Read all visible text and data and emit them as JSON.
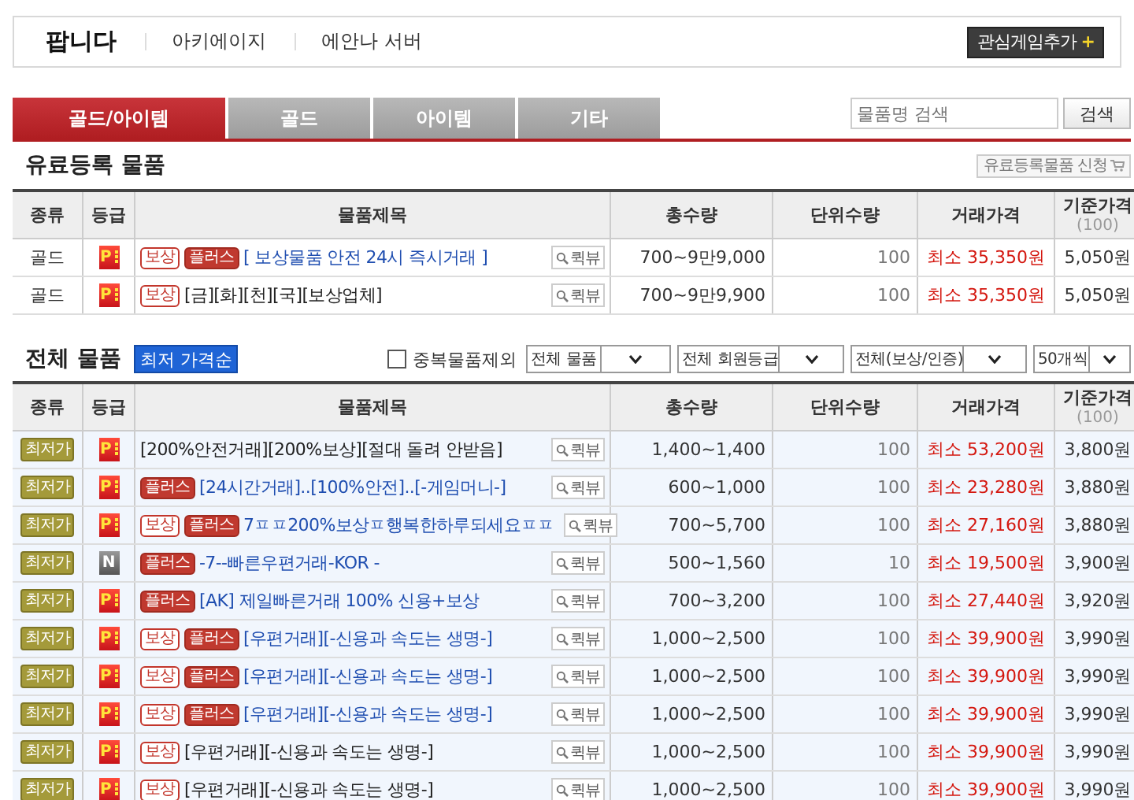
{
  "header": {
    "title": "팝니다",
    "game": "아키에이지",
    "server": "에안나 서버",
    "add_button": "관심게임추가",
    "add_icon": "+"
  },
  "tabs": [
    {
      "label": "골드/아이템",
      "selected": true
    },
    {
      "label": "골드",
      "selected": false
    },
    {
      "label": "아이템",
      "selected": false
    },
    {
      "label": "기타",
      "selected": false
    }
  ],
  "search": {
    "placeholder": "물품명 검색",
    "button": "검색"
  },
  "premium": {
    "title": "유료등록 물품",
    "apply_button": "유료등록물품 신청",
    "columns": [
      {
        "label": "종류"
      },
      {
        "label": "등급"
      },
      {
        "label": "물품제목"
      },
      {
        "label": "총수량"
      },
      {
        "label": "단위수량"
      },
      {
        "label": "거래가격"
      },
      {
        "label": "기준가격",
        "sub": "(100)"
      }
    ],
    "rows": [
      {
        "kind": "text",
        "type": "골드",
        "grade": "P",
        "tags": [
          {
            "kind": "compensation",
            "label": "보상"
          },
          {
            "kind": "plus",
            "label": "플러스"
          }
        ],
        "title": "[ 보상물품 안전 24시 즉시거래 ]",
        "highlighted": true,
        "quick_view": "퀵뷰",
        "total": "700~9만9,000",
        "unit": "100",
        "price": "최소 35,350원",
        "base": "5,050원"
      },
      {
        "kind": "text",
        "type": "골드",
        "grade": "P",
        "tags": [
          {
            "kind": "compensation",
            "label": "보상"
          }
        ],
        "title": "[금][화][천][국][보상업체]",
        "highlighted": false,
        "quick_view": "퀵뷰",
        "total": "700~9만9,900",
        "unit": "100",
        "price": "최소 35,350원",
        "base": "5,050원"
      }
    ]
  },
  "all": {
    "title": "전체 물품",
    "sort_button": "최저 가격순",
    "exclude": {
      "label": "중복물품제외",
      "checked": false
    },
    "filters": [
      "전체 물품",
      "전체 회원등급",
      "전체(보상/인증)",
      "50개씩"
    ],
    "columns": [
      {
        "label": "종류"
      },
      {
        "label": "등급"
      },
      {
        "label": "물품제목"
      },
      {
        "label": "총수량"
      },
      {
        "label": "단위수량"
      },
      {
        "label": "거래가격"
      },
      {
        "label": "기준가격",
        "sub": "(100)"
      }
    ],
    "rows": [
      {
        "kind": "badge",
        "type": "최저가",
        "grade": "P",
        "tags": [],
        "title": "[200%안전거래][200%보상][절대 돌려 안받음]",
        "highlighted": false,
        "quick_view": "퀵뷰",
        "total": "1,400~1,400",
        "unit": "100",
        "price": "최소 53,200원",
        "base": "3,800원"
      },
      {
        "kind": "badge",
        "type": "최저가",
        "grade": "P",
        "tags": [
          {
            "kind": "plus",
            "label": "플러스"
          }
        ],
        "title": "[24시간거래]..[100%안전]..[-게임머니-]",
        "highlighted": true,
        "quick_view": "퀵뷰",
        "total": "600~1,000",
        "unit": "100",
        "price": "최소 23,280원",
        "base": "3,880원"
      },
      {
        "kind": "badge",
        "type": "최저가",
        "grade": "P",
        "tags": [
          {
            "kind": "compensation",
            "label": "보상"
          },
          {
            "kind": "plus",
            "label": "플러스"
          }
        ],
        "title": "7ㅍㅍ200%보상ㅍ행복한하루되세요ㅍㅍ",
        "highlighted": true,
        "quick_view": "퀵뷰",
        "total": "700~5,700",
        "unit": "100",
        "price": "최소 27,160원",
        "base": "3,880원"
      },
      {
        "kind": "badge",
        "type": "최저가",
        "grade": "N",
        "tags": [
          {
            "kind": "plus",
            "label": "플러스"
          }
        ],
        "title": "-7--빠른우편거래-KOR -",
        "highlighted": true,
        "quick_view": "퀵뷰",
        "total": "500~1,560",
        "unit": "10",
        "price": "최소 19,500원",
        "base": "3,900원"
      },
      {
        "kind": "badge",
        "type": "최저가",
        "grade": "P",
        "tags": [
          {
            "kind": "plus",
            "label": "플러스"
          }
        ],
        "title": "[AK] 제일빠른거래 100% 신용+보상",
        "highlighted": true,
        "quick_view": "퀵뷰",
        "total": "700~3,200",
        "unit": "100",
        "price": "최소 27,440원",
        "base": "3,920원"
      },
      {
        "kind": "badge",
        "type": "최저가",
        "grade": "P",
        "tags": [
          {
            "kind": "compensation",
            "label": "보상"
          },
          {
            "kind": "plus",
            "label": "플러스"
          }
        ],
        "title": "[우편거래][-신용과 속도는 생명-]",
        "highlighted": true,
        "quick_view": "퀵뷰",
        "total": "1,000~2,500",
        "unit": "100",
        "price": "최소 39,900원",
        "base": "3,990원"
      },
      {
        "kind": "badge",
        "type": "최저가",
        "grade": "P",
        "tags": [
          {
            "kind": "compensation",
            "label": "보상"
          },
          {
            "kind": "plus",
            "label": "플러스"
          }
        ],
        "title": "[우편거래][-신용과 속도는 생명-]",
        "highlighted": true,
        "quick_view": "퀵뷰",
        "total": "1,000~2,500",
        "unit": "100",
        "price": "최소 39,900원",
        "base": "3,990원"
      },
      {
        "kind": "badge",
        "type": "최저가",
        "grade": "P",
        "tags": [
          {
            "kind": "compensation",
            "label": "보상"
          },
          {
            "kind": "plus",
            "label": "플러스"
          }
        ],
        "title": "[우편거래][-신용과 속도는 생명-]",
        "highlighted": true,
        "quick_view": "퀵뷰",
        "total": "1,000~2,500",
        "unit": "100",
        "price": "최소 39,900원",
        "base": "3,990원"
      },
      {
        "kind": "badge",
        "type": "최저가",
        "grade": "P",
        "tags": [
          {
            "kind": "compensation",
            "label": "보상"
          }
        ],
        "title": "[우편거래][-신용과 속도는 생명-]",
        "highlighted": false,
        "quick_view": "퀵뷰",
        "total": "1,000~2,500",
        "unit": "100",
        "price": "최소 39,900원",
        "base": "3,990원"
      },
      {
        "kind": "badge",
        "type": "최저가",
        "grade": "P",
        "tags": [
          {
            "kind": "compensation",
            "label": "보상"
          }
        ],
        "title": "[우편거래][-신용과 속도는 생명-]",
        "highlighted": false,
        "quick_view": "퀵뷰",
        "total": "1,000~2,500",
        "unit": "100",
        "price": "최소 39,900원",
        "base": "3,990원"
      }
    ]
  }
}
